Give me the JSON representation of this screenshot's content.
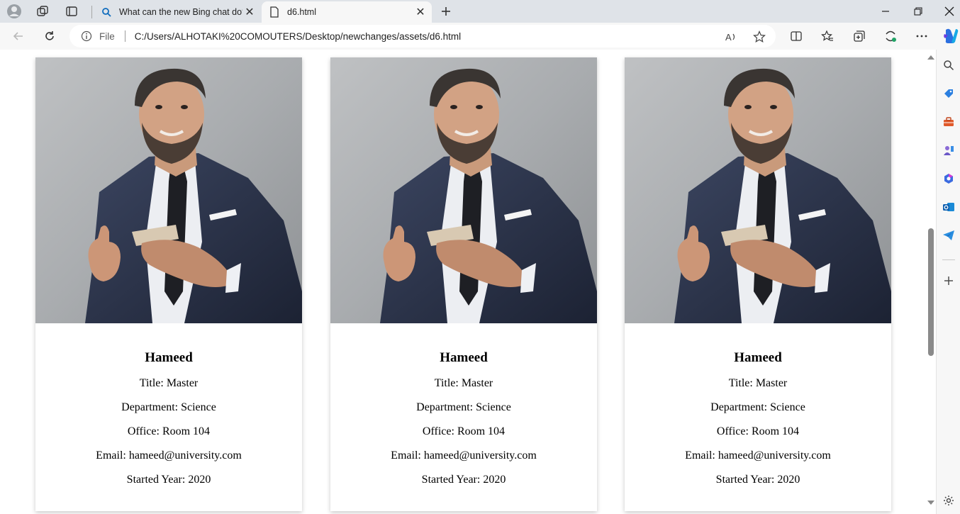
{
  "browser": {
    "tabs": [
      {
        "title": "What can the new Bing chat do?",
        "active": false
      },
      {
        "title": "d6.html",
        "active": true
      }
    ],
    "address": {
      "scheme_label": "File",
      "url": "C:/Users/ALHOTAKI%20COMOUTERS/Desktop/newchanges/assets/d6.html"
    }
  },
  "cards": [
    {
      "name": "Hameed",
      "title": "Title: Master",
      "department": "Department: Science",
      "office": "Office: Room 104",
      "email": "Email: hameed@university.com",
      "started": "Started Year: 2020"
    },
    {
      "name": "Hameed",
      "title": "Title: Master",
      "department": "Department: Science",
      "office": "Office: Room 104",
      "email": "Email: hameed@university.com",
      "started": "Started Year: 2020"
    },
    {
      "name": "Hameed",
      "title": "Title: Master",
      "department": "Department: Science",
      "office": "Office: Room 104",
      "email": "Email: hameed@university.com",
      "started": "Started Year: 2020"
    }
  ],
  "colors": {
    "tabstrip": "#dfe3e8",
    "toolbar": "#f7f7f7",
    "accent": "#0f6cbd"
  }
}
